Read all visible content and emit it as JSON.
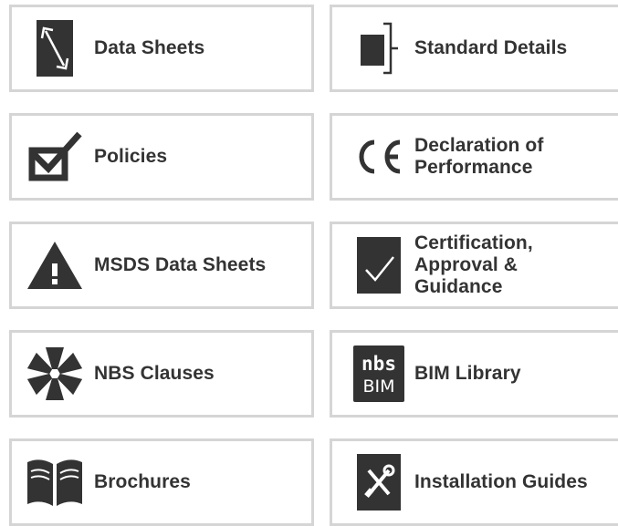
{
  "colors": {
    "icon": "#333333",
    "text": "#333333",
    "border": "#d5d5d5"
  },
  "tiles": [
    {
      "label": "Data Sheets",
      "icon": "diagonal-arrow-document-icon"
    },
    {
      "label": "Standard Details",
      "icon": "detail-bracket-icon"
    },
    {
      "label": "Policies",
      "icon": "checkbox-tick-icon"
    },
    {
      "label": "Declaration of\nPerformance",
      "icon": "ce-mark-icon"
    },
    {
      "label": "MSDS Data Sheets",
      "icon": "warning-triangle-icon"
    },
    {
      "label": "Certification,\nApproval &\nGuidance",
      "icon": "check-square-icon"
    },
    {
      "label": "NBS Clauses",
      "icon": "nbs-flower-icon"
    },
    {
      "label": "BIM Library",
      "icon": "nbs-bim-logo-icon"
    },
    {
      "label": "Brochures",
      "icon": "open-book-icon"
    },
    {
      "label": "Installation Guides",
      "icon": "tools-icon"
    }
  ],
  "bim_logo": {
    "line1": "nbs",
    "line2": "BIM"
  }
}
